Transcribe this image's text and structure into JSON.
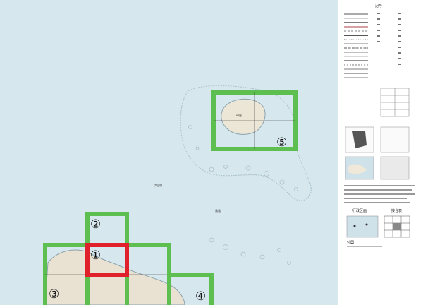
{
  "colors": {
    "sea": "#d6e7ee",
    "coastline": "#9ab2bd",
    "land": "#e9e2d2",
    "tile_border": "#5cbf4f",
    "tile_highlight": "#e0202a",
    "legend_bg": "#ffffff"
  },
  "tiles": [
    {
      "id": "1",
      "label": "①",
      "highlighted": true
    },
    {
      "id": "2",
      "label": "②",
      "highlighted": false
    },
    {
      "id": "3",
      "label": "③",
      "highlighted": false
    },
    {
      "id": "4",
      "label": "④",
      "highlighted": false
    },
    {
      "id": "5",
      "label": "⑤",
      "highlighted": false
    }
  ],
  "map_text": {
    "place_1": "母島",
    "place_2": "伊豆村",
    "place_3": "鳥島"
  },
  "legend": {
    "title": "記号",
    "index_title": "行政区画",
    "index_title_2": "接合表",
    "footer": "付図"
  }
}
